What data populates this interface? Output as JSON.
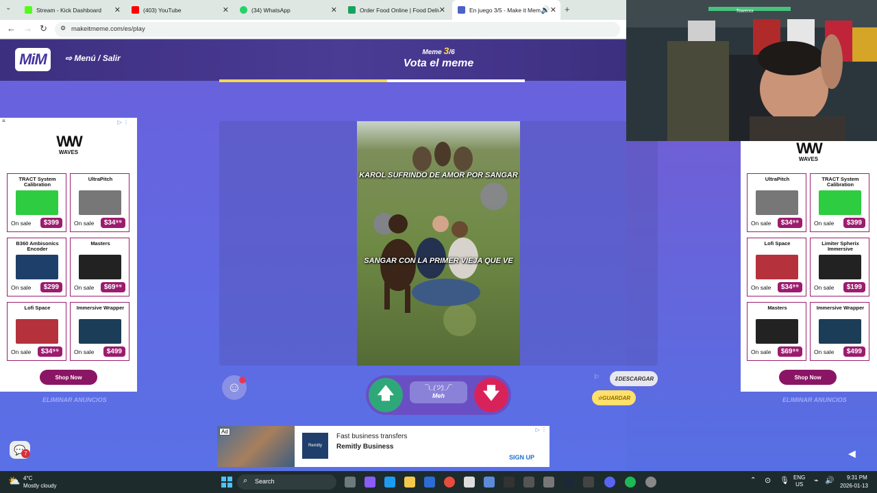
{
  "browser": {
    "tabs": [
      {
        "label": "Stream - Kick Dashboard",
        "color": "#53fc18"
      },
      {
        "label": "(403) YouTube",
        "color": "#ff0000"
      },
      {
        "label": "(34) WhatsApp",
        "color": "#25d366"
      },
      {
        "label": "Order Food Online | Food Deliv",
        "color": "#1aa260"
      },
      {
        "label": "En juego 3/5 - Make it Mem",
        "color": "#4a62c9"
      }
    ],
    "new_tab": "+",
    "url": "makeitmeme.com/es/play"
  },
  "header": {
    "logo": "MiM",
    "menu_link": "Menú / Salir",
    "meme_label": "Meme",
    "meme_current": "3",
    "meme_total": "/6",
    "title": "Vota el meme",
    "progress": 0.55
  },
  "ads_left": {
    "brand": "WAVES",
    "products": [
      {
        "name": "TRACT System Calibration",
        "sale": "On sale",
        "price": "$399",
        "color": "#2ecc40"
      },
      {
        "name": "UltraPitch",
        "sale": "On sale",
        "price": "$34⁹⁹",
        "color": "#777"
      },
      {
        "name": "B360 Ambisonics Encoder",
        "sale": "On sale",
        "price": "$299",
        "color": "#1e3f6a"
      },
      {
        "name": "Masters",
        "sale": "On sale",
        "price": "$69⁹⁹",
        "color": "#222"
      },
      {
        "name": "Lofi Space",
        "sale": "On sale",
        "price": "$34⁹⁹",
        "color": "#b5323c"
      },
      {
        "name": "Immersive Wrapper",
        "sale": "On sale",
        "price": "$499",
        "color": "#1b3d57"
      }
    ],
    "shop_button": "Shop Now",
    "remove_ads": "ELIMINAR ANUNCIOS"
  },
  "ads_right": {
    "brand": "WAVES",
    "products": [
      {
        "name": "UltraPitch",
        "sale": "On sale",
        "price": "$34⁹⁹",
        "color": "#777"
      },
      {
        "name": "TRACT System Calibration",
        "sale": "On sale",
        "price": "$399",
        "color": "#2ecc40"
      },
      {
        "name": "Lofi Space",
        "sale": "On sale",
        "price": "$34⁹⁹",
        "color": "#b5323c"
      },
      {
        "name": "Limiter Spherix Immersive",
        "sale": "On sale",
        "price": "$199",
        "color": "#222"
      },
      {
        "name": "Masters",
        "sale": "On sale",
        "price": "$69⁹⁹",
        "color": "#222"
      },
      {
        "name": "Immersive Wrapper",
        "sale": "On sale",
        "price": "$499",
        "color": "#1b3d57"
      }
    ],
    "shop_button": "Shop Now",
    "remove_ads": "ELIMINAR ANUNCIOS"
  },
  "meme": {
    "caption_top": "KAROL SUFRINDO DE AMOR POR SANGAR",
    "caption_bottom": "SANGAR CON LA PRIMER VIEJA QUE VE"
  },
  "controls": {
    "meh_face": "¯\\_(ツ)_/¯",
    "meh_label": "Meh",
    "upvote": "🡅",
    "downvote": "🡇",
    "download": "DESCARGAR",
    "save": "GUARDAR"
  },
  "bottom_ad": {
    "badge": "Ad",
    "title": "Fast business transfers",
    "advertiser": "Remitly Business",
    "cta": "SIGN UP",
    "logo_text": "Remitly"
  },
  "chat": {
    "badge": "7"
  },
  "taskbar": {
    "temperature": "4°C",
    "weather": "Mostly cloudy",
    "search": "Search",
    "lang": "ENG",
    "region": "US",
    "time": "9:31 PM",
    "date": "2026-01-13"
  },
  "webcam": {
    "overlay_name": "Towerxx"
  }
}
